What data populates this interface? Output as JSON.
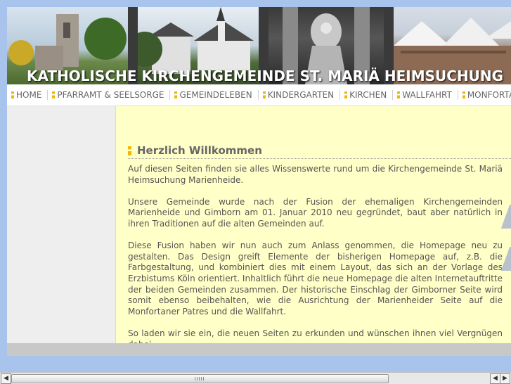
{
  "banner": {
    "title": "KATHOLISCHE KIRCHENGEMEINDE ST. MARIÄ HEIMSUCHUNG"
  },
  "nav": {
    "items": [
      "HOME",
      "PFARRAMT & SEELSORGE",
      "GEMEINDELEBEN",
      "KINDERGARTEN",
      "KIRCHEN",
      "WALLFAHRT",
      "MONFORTANER"
    ]
  },
  "main": {
    "heading": "Herzlich Willkommen",
    "paragraphs": [
      "Auf diesen Seiten finden sie alles Wissenswerte rund um die Kirchengemeinde St. Mariä Heimsuchung Marienheide.",
      "Unsere Gemeinde wurde nach der Fusion der ehemaligen Kirchengemeinden Marienheide und Gimborn am 01. Januar 2010 neu gegründet, baut aber natürlich in ihren Traditionen auf die alten Gemeinden auf.",
      "Diese Fusion haben wir nun auch zum Anlass genommen, die Homepage neu zu gestalten. Das Design greift Elemente der bisherigen Homepage auf, z.B. die Farbgestaltung, und kombiniert dies mit einem Layout, das sich an der Vorlage des Erzbistums Köln orientiert. Inhaltlich führt die neue Homepage die alten Internetauftritte der beiden Gemeinden zusammen. Der historische Einschlag der Gimborner Seite wird somit ebenso beibehalten, wie die Ausrichtung der Marienheider Seite auf die Monfortaner Patres und die Wallfahrt.",
      "So laden wir sie ein, die neuen Seiten zu erkunden und wünschen ihnen viel Vergnügen dabei."
    ]
  },
  "colors": {
    "accent": "#f0b800",
    "content_bg": "#ffffc8",
    "page_bg": "#a8c4ec"
  },
  "icons": {
    "nav_bullet": "yellow-bullet-icon",
    "scroll_left": "arrow-left-icon",
    "scroll_right": "arrow-right-icon"
  }
}
